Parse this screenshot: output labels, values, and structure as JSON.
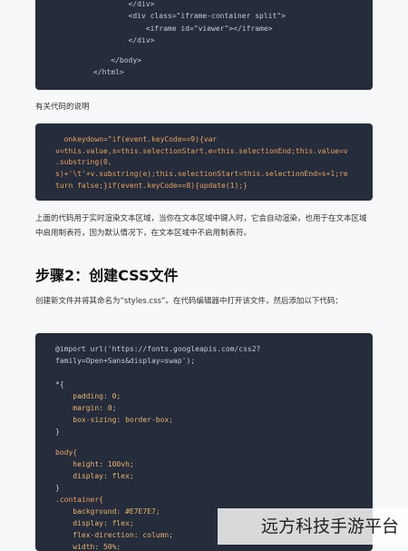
{
  "block1": {
    "lines": [
      "        </div>",
      "        <div class=\"iframe-container split\">",
      "            <iframe id=\"viewer\"></iframe>",
      "        </div>",
      "",
      "    </body>",
      "</html>"
    ]
  },
  "label_code_explain": "有关代码的说明",
  "block2": {
    "lines": [
      "  onkeydown=\"if(event.keyCode==9){var",
      "v=this.value,s=this.selectionStart,e=this.selectionEnd;this.value=v",
      ".substring(0,",
      "s)+'\\t'+v.substring(e);this.selectionStart=this.selectionEnd=s+1;re",
      "turn false;}if(event.keyCode==8){update(1);}"
    ]
  },
  "para1": "上面的代码用于实时渲染文本区域，当你在文本区域中键入时，它会自动渲染，也用于在文本区域中启用制表符，因为默认情况下，在文本区域中不启用制表符。",
  "heading2": "步骤2：创建CSS文件",
  "para2": "创建新文件并将其命名为“styles.css”。在代码编辑器中打开该文件，然后添加以下代码：",
  "block3": {
    "lines": [
      "@import url('https://fonts.googleapis.com/css2?",
      "family=Open+Sans&display=swap');",
      "",
      "*{",
      "    padding: 0;",
      "    margin: 0;",
      "    box-sizing: border-box;",
      "}",
      "",
      "body{",
      "    height: 100vh;",
      "    display: flex;",
      "}",
      ".container{",
      "    background: #E7E7E7;",
      "    display: flex;",
      "    flex-direction: column;",
      "    width: 50%;"
    ]
  },
  "watermark": "远方科技手游平台"
}
